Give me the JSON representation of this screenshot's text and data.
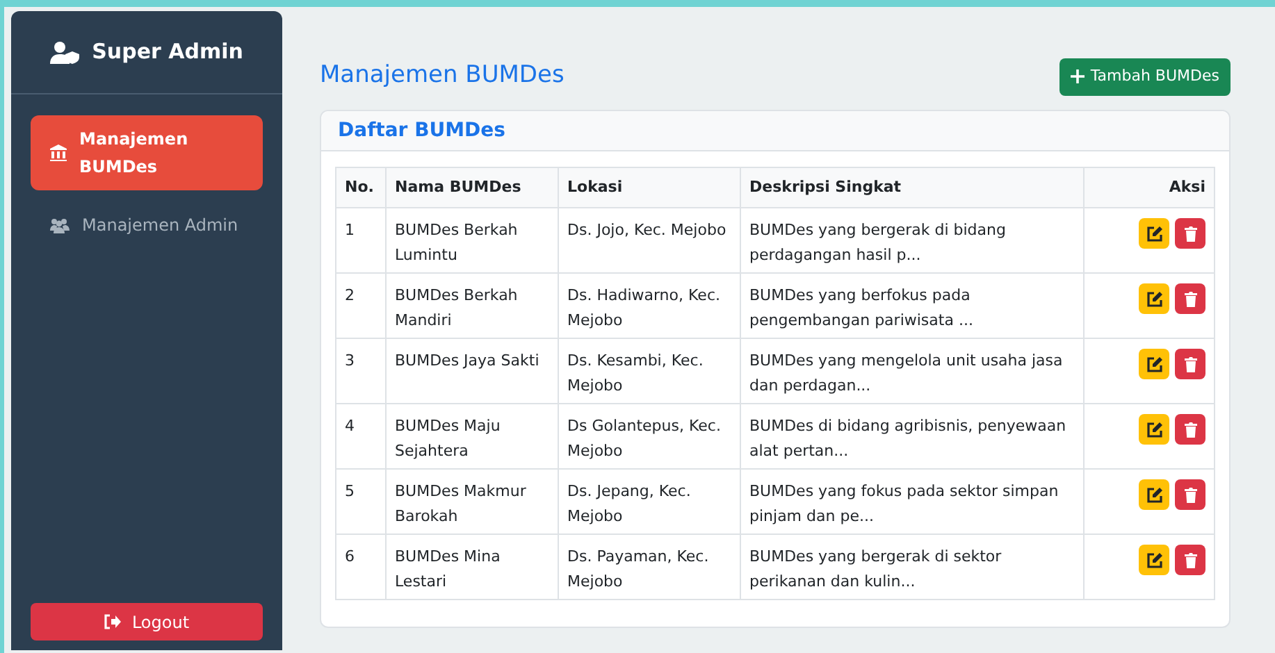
{
  "sidebar": {
    "title": "Super Admin",
    "items": [
      {
        "label": "Manajemen BUMDes",
        "selected": true,
        "kind": "bank"
      },
      {
        "label": "Manajemen Admin",
        "selected": false,
        "kind": "users"
      }
    ],
    "logout": "Logout"
  },
  "page": {
    "title": "Manajemen BUMDes",
    "add_button": "Tambah BUMDes"
  },
  "card": {
    "title": "Daftar BUMDes"
  },
  "table": {
    "columns": [
      "No.",
      "Nama BUMDes",
      "Lokasi",
      "Deskripsi Singkat",
      "Aksi"
    ],
    "rows": [
      [
        "1",
        "BUMDes Berkah Lumintu",
        "Ds. Jojo, Kec. Mejobo",
        "BUMDes yang bergerak di bidang perdagangan hasil p..."
      ],
      [
        "2",
        "BUMDes Berkah Mandiri",
        "Ds. Hadiwarno, Kec. Mejobo",
        "BUMDes yang berfokus pada pengembangan pariwisata ..."
      ],
      [
        "3",
        "BUMDes Jaya Sakti",
        "Ds. Kesambi, Kec. Mejobo",
        "BUMDes yang mengelola unit usaha jasa dan perdagan..."
      ],
      [
        "4",
        "BUMDes Maju Sejahtera",
        "Ds Golantepus, Kec. Mejobo",
        "BUMDes di bidang agribisnis, penyewaan alat pertan..."
      ],
      [
        "5",
        "BUMDes Makmur Barokah",
        "Ds. Jepang, Kec. Mejobo",
        "BUMDes yang fokus pada sektor simpan pinjam dan pe..."
      ],
      [
        "6",
        "BUMDes Mina Lestari",
        "Ds. Payaman, Kec. Mejobo",
        "BUMDes yang bergerak di sektor perikanan dan kulin..."
      ]
    ]
  }
}
